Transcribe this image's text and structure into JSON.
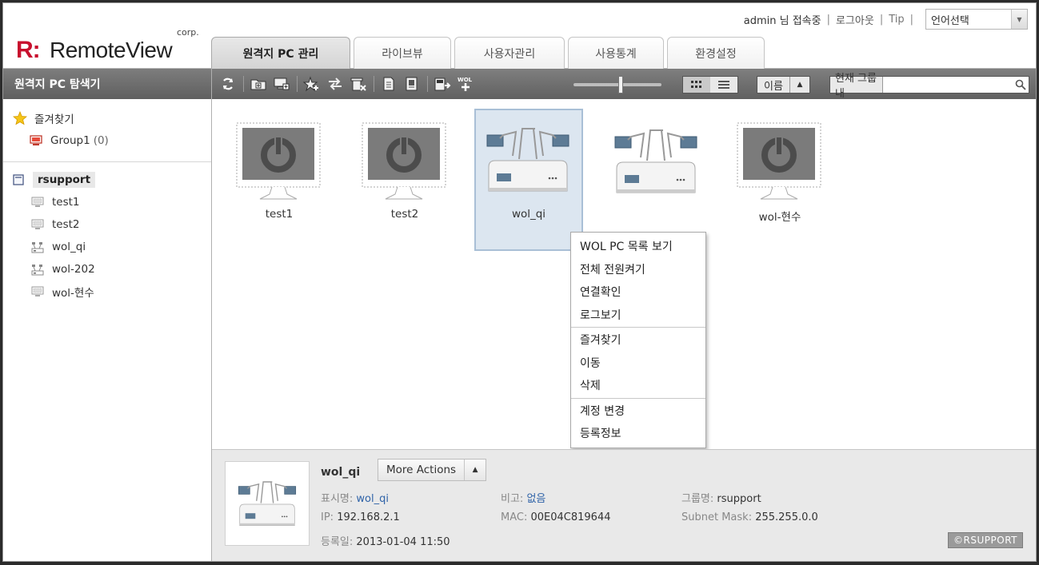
{
  "header": {
    "logo_corp": "corp.",
    "logo_mark": "R:",
    "logo_name": "RemoteView",
    "user": "admin 님 접속중",
    "logout": "로그아웃",
    "tip": "Tip",
    "language": "언어선택"
  },
  "tabs": [
    {
      "label": "원격지 PC 관리",
      "active": true
    },
    {
      "label": "라이브뷰",
      "active": false
    },
    {
      "label": "사용자관리",
      "active": false
    },
    {
      "label": "사용통계",
      "active": false
    },
    {
      "label": "환경설정",
      "active": false
    }
  ],
  "sidebar": {
    "title": "원격지 PC 탐색기",
    "favorites_label": "즐겨찾기",
    "fav_group": "Group1",
    "fav_group_count": "(0)",
    "root": "rsupport",
    "items": [
      {
        "label": "test1",
        "icon": "pc-icon"
      },
      {
        "label": "test2",
        "icon": "pc-icon"
      },
      {
        "label": "wol_qi",
        "icon": "wol-device-icon"
      },
      {
        "label": "wol-202",
        "icon": "wol-device-icon"
      },
      {
        "label": "wol-현수",
        "icon": "pc-icon"
      }
    ]
  },
  "toolbar": {
    "sort_label": "이름",
    "search_scope": "현재 그룹내",
    "search_placeholder": "",
    "wol_badge": "WOL"
  },
  "pcs": [
    {
      "label": "test1",
      "type": "pc"
    },
    {
      "label": "test2",
      "type": "pc"
    },
    {
      "label": "wol_qi",
      "type": "wol"
    },
    {
      "label": "",
      "type": "wol"
    },
    {
      "label": "wol-현수",
      "type": "pc"
    }
  ],
  "context_menu": {
    "group1": [
      "WOL PC 목록 보기",
      "전체 전원켜기",
      "연결확인",
      "로그보기"
    ],
    "group2": [
      "즐겨찾기",
      "이동",
      "삭제"
    ],
    "group3": [
      "계정 변경",
      "등록정보"
    ]
  },
  "detail": {
    "name": "wol_qi",
    "more_actions": "More Actions",
    "display_name_label": "표시명:",
    "display_name": "wol_qi",
    "ip_label": "IP:",
    "ip": "192.168.2.1",
    "reg_label": "등록일:",
    "reg_date": "2013-01-04 11:50",
    "note_label": "비고:",
    "note": "없음",
    "mac_label": "MAC:",
    "mac": "00E04C819644",
    "group_label": "그룹명:",
    "group": "rsupport",
    "subnet_label": "Subnet Mask:",
    "subnet": "255.255.0.0",
    "copyright": "©RSUPPORT"
  },
  "colors": {
    "brand_red": "#c8102e",
    "toolbar_gray": "#6e6e6e",
    "selection_blue": "#dce6f0",
    "link_blue": "#2f63a8"
  }
}
